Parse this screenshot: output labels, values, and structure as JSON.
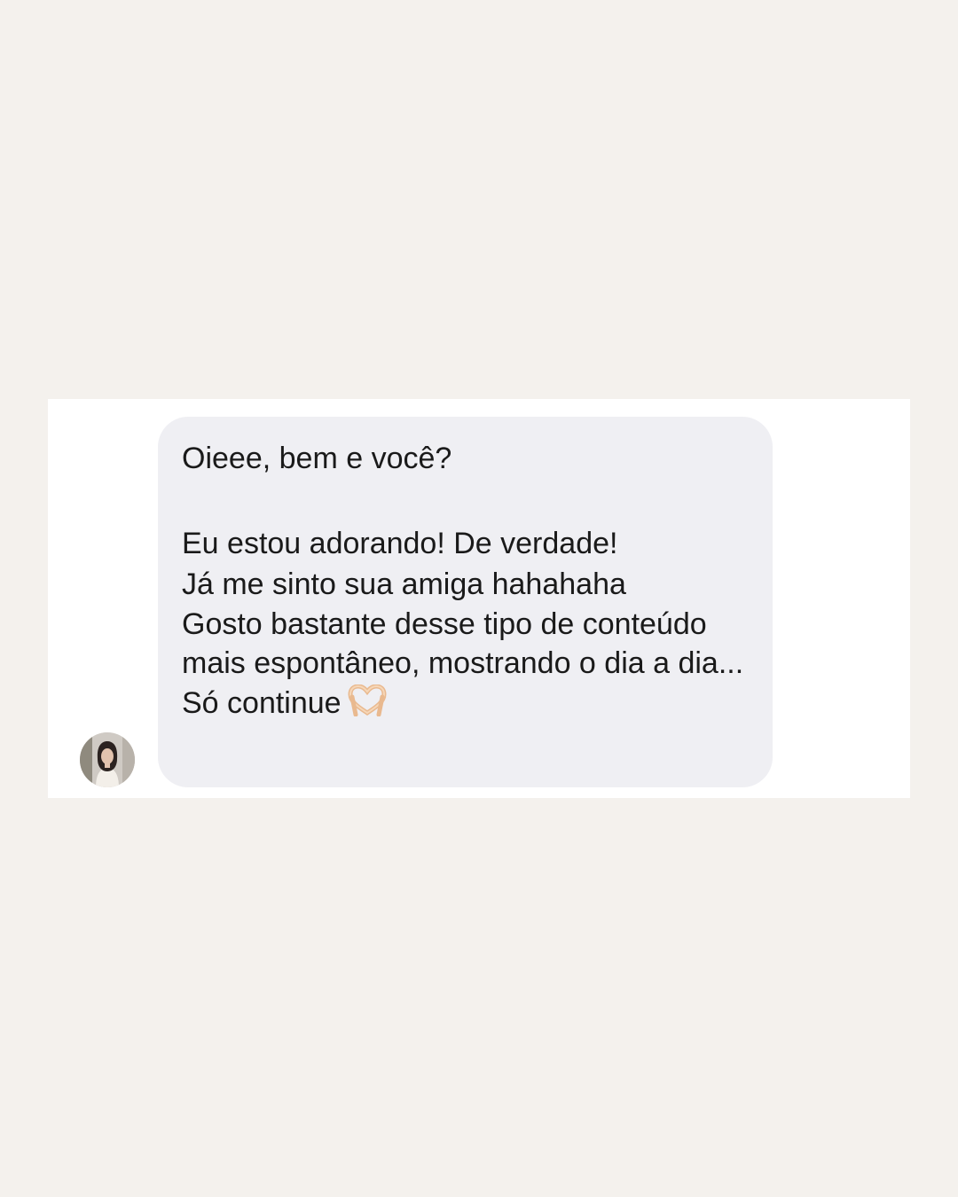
{
  "chat": {
    "message": {
      "line1": "Oieee, bem e você?",
      "line2": "Eu estou adorando! De verdade!",
      "line3": "Já me sinto sua amiga hahahaha",
      "line4": "Gosto bastante desse tipo de conteúdo mais espontâneo, mostrando o dia a dia...",
      "line5": "Só continue",
      "emoji": "heart-hands-emoji"
    },
    "sender": {
      "avatar": "avatar-photo"
    }
  },
  "colors": {
    "page_background": "#f4f1ed",
    "card_background": "#ffffff",
    "bubble_background": "#efeff3",
    "text": "#1a1a1a"
  }
}
